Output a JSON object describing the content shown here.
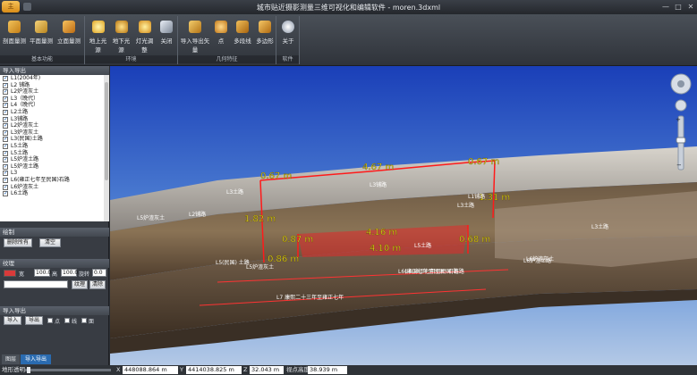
{
  "window": {
    "title": "城市贴近摄影测量三维可视化和编辑软件 - moren.3dxml",
    "app_button": "主",
    "controls": {
      "minimize": "—",
      "maximize": "□",
      "close": "✕"
    }
  },
  "ribbon": {
    "groups": [
      {
        "label": "基本功能",
        "buttons": [
          "剖面量测",
          "平面量测",
          "立面量测"
        ]
      },
      {
        "label": "环境",
        "buttons": [
          "地上光源",
          "地下光源",
          "灯光调整",
          "关闭"
        ]
      },
      {
        "label": "几何特征",
        "buttons": [
          "导入导出矢量",
          "点",
          "多段线",
          "多边形"
        ]
      },
      {
        "label": "软件",
        "buttons": [
          "关于"
        ]
      }
    ]
  },
  "panel": {
    "import_export_header": "导入导出",
    "layers": [
      "L1(2004年)",
      "L2 铺路",
      "L2炉渣灰土",
      "L3（晚代）",
      "L4（晚代）",
      "L2土路",
      "L3铺路",
      "L2炉渣灰土",
      "L3炉渣灰土",
      "L3(民国)土路",
      "L5土路",
      "L5土路",
      "L5炉渣土路",
      "L5炉渣土路",
      "L3",
      "L6(雍正七年至民国)石路",
      "L6炉渣灰土",
      "L6土路"
    ],
    "draw": {
      "header": "绘制",
      "delete_all": "删除所有",
      "clear": "清空"
    },
    "texture": {
      "header": "纹理",
      "width_label": "宽",
      "width_value": "100.0",
      "height_label": "高",
      "height_value": "100.0",
      "rotate_label": "旋转",
      "rotate_value": "0.0",
      "apply": "纹理",
      "clear": "清除"
    },
    "import_export": {
      "header": "导入导出",
      "import": "导入",
      "export": "导出",
      "opt_point": "点",
      "opt_line": "线",
      "opt_polygon": "面"
    },
    "tabs": [
      "图层",
      "导入导出"
    ]
  },
  "viewport": {
    "measurements": [
      "0.67 m",
      "4.67 m",
      "0.67 m",
      "1.31 m",
      "1.82 m",
      "0.87 m",
      "4.16 m",
      "4.10 m",
      "0.68 m",
      "0.86 m"
    ],
    "labels": [
      "L2铺路",
      "L3土路",
      "L5炉渣灰土",
      "L3铺路",
      "L1铺路",
      "L3土路",
      "L5土路",
      "L5(民国) 土路",
      "L5炉渣灰土",
      "L6炉渣灰土",
      "L6(雍正七年至民国) 石路",
      "L6(雍正七年至民国)石路",
      "L6炉渣土路",
      "L3土路",
      "L7 康熙二十三年至雍正七年"
    ]
  },
  "status": {
    "label": "地形透明",
    "x_label": "X",
    "x_value": "448088.864 m",
    "y_label": "Y",
    "y_value": "4414038.825 m",
    "z_label": "Z",
    "z_value": "32.043 m",
    "view_label": "视点高度",
    "view_value": "38.939 m"
  }
}
